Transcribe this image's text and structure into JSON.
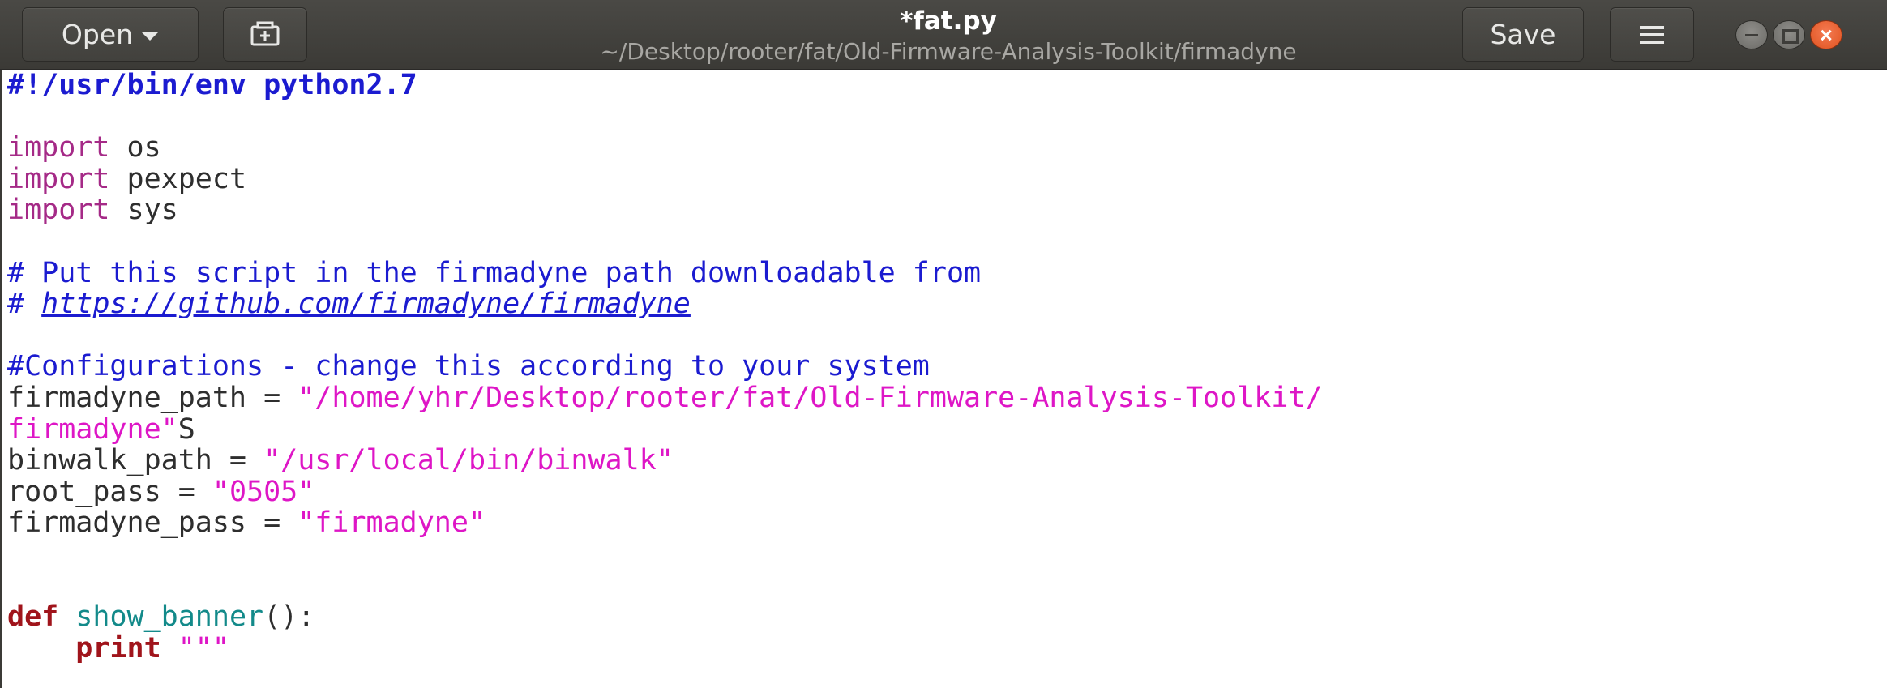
{
  "header": {
    "open_label": "Open",
    "title": "*fat.py",
    "subtitle": "~/Desktop/rooter/fat/Old-Firmware-Analysis-Toolkit/firmadyne",
    "save_label": "Save",
    "icons": {
      "open_dropdown": "chevron-down-icon",
      "new_tab": "new-document-icon",
      "menu": "hamburger-menu-icon",
      "minimize": "minimize-icon",
      "maximize": "maximize-icon",
      "close": "close-icon"
    },
    "colors": {
      "close_button": "#e0531f",
      "headerbar": "#3b3a36"
    }
  },
  "editor": {
    "lines": [
      [
        {
          "t": "#!/usr/bin/env python2.7",
          "c": "shebang"
        }
      ],
      [],
      [
        {
          "t": "import",
          "c": "kw"
        },
        {
          "t": " os",
          "c": "text"
        }
      ],
      [
        {
          "t": "import",
          "c": "kw"
        },
        {
          "t": " pexpect",
          "c": "text"
        }
      ],
      [
        {
          "t": "import",
          "c": "kw"
        },
        {
          "t": " sys",
          "c": "text"
        }
      ],
      [],
      [
        {
          "t": "# Put this script in the firmadyne path downloadable from",
          "c": "comment"
        }
      ],
      [
        {
          "t": "# ",
          "c": "comment"
        },
        {
          "t": "https://github.com/firmadyne/firmadyne",
          "c": "url"
        }
      ],
      [],
      [
        {
          "t": "#Configurations - change this according to your system",
          "c": "comment"
        }
      ],
      [
        {
          "t": "firmadyne_path = ",
          "c": "text"
        },
        {
          "t": "\"/home/yhr/Desktop/rooter/fat/Old-Firmware-Analysis-Toolkit/",
          "c": "string"
        }
      ],
      [
        {
          "t": "firmadyne\"",
          "c": "string"
        },
        {
          "t": "S",
          "c": "text"
        }
      ],
      [
        {
          "t": "binwalk_path = ",
          "c": "text"
        },
        {
          "t": "\"/usr/local/bin/binwalk\"",
          "c": "string"
        }
      ],
      [
        {
          "t": "root_pass = ",
          "c": "text"
        },
        {
          "t": "\"0505\"",
          "c": "string"
        }
      ],
      [
        {
          "t": "firmadyne_pass = ",
          "c": "text"
        },
        {
          "t": "\"firmadyne\"",
          "c": "string"
        }
      ],
      [],
      [],
      [
        {
          "t": "def",
          "c": "def"
        },
        {
          "t": " ",
          "c": "text"
        },
        {
          "t": "show_banner",
          "c": "func"
        },
        {
          "t": "():",
          "c": "text"
        }
      ],
      [
        {
          "t": "    ",
          "c": "text"
        },
        {
          "t": "print",
          "c": "def"
        },
        {
          "t": " ",
          "c": "text"
        },
        {
          "t": "\"\"\"",
          "c": "string"
        }
      ]
    ]
  }
}
